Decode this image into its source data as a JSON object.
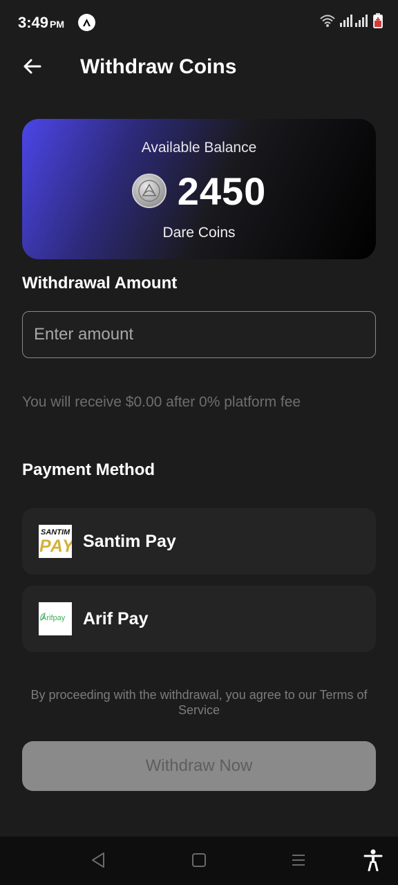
{
  "status_bar": {
    "time": "3:49",
    "ampm": "PM"
  },
  "header": {
    "title": "Withdraw Coins"
  },
  "balance": {
    "label": "Available Balance",
    "value": "2450",
    "unit": "Dare Coins"
  },
  "withdrawal": {
    "section_title": "Withdrawal Amount",
    "placeholder": "Enter amount",
    "value": "",
    "fee_note": "You will receive $0.00 after 0% platform fee"
  },
  "payment": {
    "section_title": "Payment Method",
    "methods": [
      {
        "label": "Santim Pay",
        "logo_top": "SANTIM",
        "logo_bottom": "PAY"
      },
      {
        "label": "Arif Pay",
        "logo_text": "Arifpay"
      }
    ]
  },
  "terms": "By proceeding with the withdrawal, you agree to our Terms of Service",
  "actions": {
    "withdraw_label": "Withdraw Now"
  },
  "colors": {
    "background": "#1c1c1c",
    "card_gradient_start": "#4c46e8",
    "disabled_button": "#8a8a8a"
  }
}
